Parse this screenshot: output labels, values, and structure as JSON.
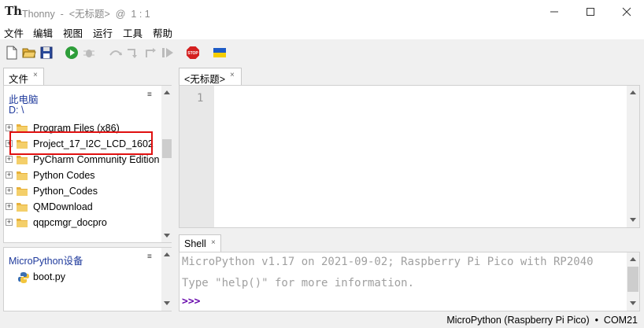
{
  "window": {
    "title": "Thonny  -  <无标题>  @  1 : 1",
    "app_icon": "Th"
  },
  "menu": [
    "文件",
    "编辑",
    "视图",
    "运行",
    "工具",
    "帮助"
  ],
  "toolbar": {
    "icons": [
      "new-file-icon",
      "open-file-icon",
      "save-icon",
      "run-icon",
      "debug-icon",
      "step-over-icon",
      "step-into-icon",
      "step-out-icon",
      "resume-icon",
      "stop-icon",
      "ukraine-flag-icon"
    ],
    "stop_label": "STOP"
  },
  "files": {
    "tab_label": "文件",
    "tab_close": "×",
    "pc_label": "此电脑",
    "path": "D: \\",
    "menu_glyph": "≡",
    "items": [
      {
        "label": "Program Files (x86)"
      },
      {
        "label": "Project_17_I2C_LCD_1602",
        "highlighted": true
      },
      {
        "label": "PyCharm Community Edition"
      },
      {
        "label": "Python Codes"
      },
      {
        "label": "Python_Codes"
      },
      {
        "label": "QMDownload"
      },
      {
        "label": "qqpcmgr_docpro"
      }
    ]
  },
  "device": {
    "label": "MicroPython设备",
    "menu_glyph": "≡",
    "files": [
      "boot.py"
    ]
  },
  "editor": {
    "tab_label": "<无标题>",
    "tab_close": "×",
    "line_numbers": [
      "1"
    ]
  },
  "shell": {
    "tab_label": "Shell",
    "tab_close": "×",
    "lines": [
      "MicroPython v1.17 on 2021-09-02; Raspberry Pi Pico with RP2040",
      "Type \"help()\" for more information."
    ],
    "prompt": ">>>"
  },
  "status": {
    "text": "MicroPython (Raspberry Pi Pico)  •  COM21"
  },
  "colors": {
    "highlight_box": "#e01010",
    "folder": "#e8b13a",
    "link_blue": "#1f3a9c",
    "prompt": "#6a0dad"
  }
}
